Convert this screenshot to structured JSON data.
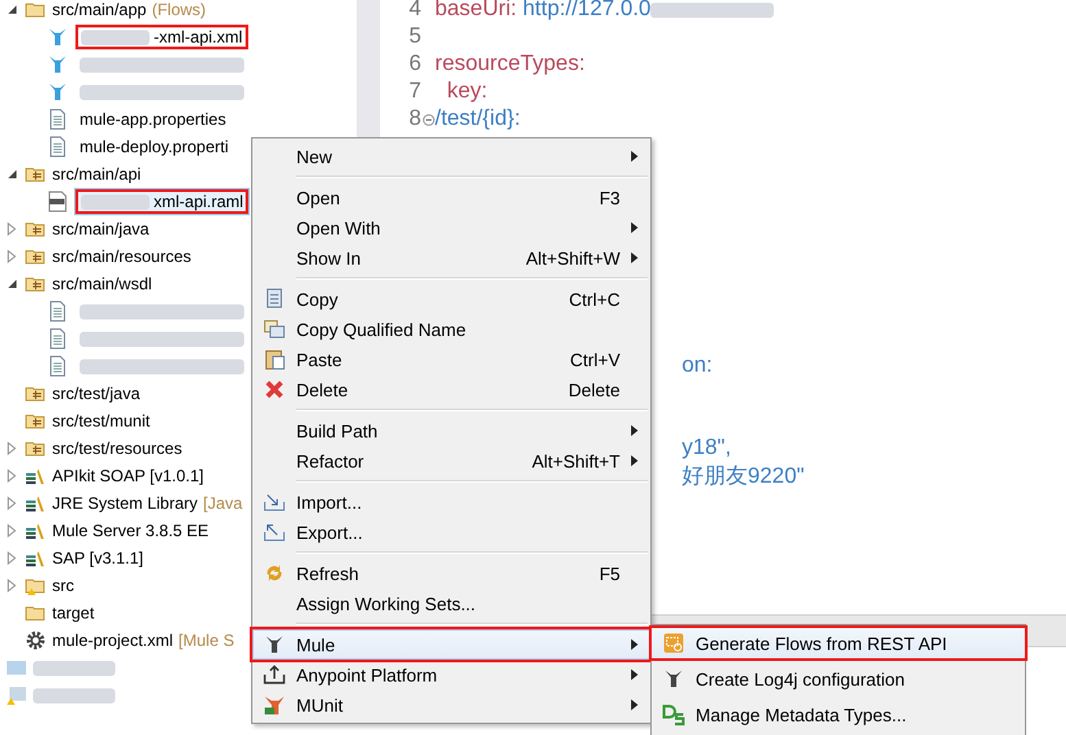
{
  "tree": [
    {
      "kind": "folder",
      "label": "src/main/app",
      "decoration": "(Flows)",
      "expanded": true,
      "children": [
        {
          "kind": "mule",
          "label": "-xml-api.xml",
          "blurred": true,
          "highlighted": true,
          "selected": false
        },
        {
          "kind": "mule",
          "blurred": true,
          "highlighted": false,
          "selected": false
        },
        {
          "kind": "mule",
          "blurred": true,
          "highlighted": false,
          "selected": false
        },
        {
          "kind": "file",
          "label": "mule-app.properties",
          "highlighted": false,
          "selected": false
        },
        {
          "kind": "file",
          "label": "mule-deploy.properti",
          "highlighted": false,
          "selected": false
        }
      ]
    },
    {
      "kind": "package",
      "label": "src/main/api",
      "expanded": true,
      "children": [
        {
          "kind": "raml",
          "label": "xml-api.raml",
          "blurred": true,
          "highlighted": true,
          "selected": true
        }
      ]
    },
    {
      "kind": "package",
      "label": "src/main/java",
      "expanded": false
    },
    {
      "kind": "package",
      "label": "src/main/resources",
      "expanded": false
    },
    {
      "kind": "package",
      "label": "src/main/wsdl",
      "expanded": true,
      "children": [
        {
          "kind": "file",
          "blurred": true,
          "highlighted": false,
          "selected": false
        },
        {
          "kind": "file",
          "blurred": true,
          "highlighted": false,
          "selected": false
        },
        {
          "kind": "file",
          "blurred": true,
          "highlighted": false,
          "selected": false
        }
      ]
    },
    {
      "kind": "package",
      "label": "src/test/java"
    },
    {
      "kind": "package",
      "label": "src/test/munit"
    },
    {
      "kind": "package",
      "label": "src/test/resources",
      "expanded": false
    },
    {
      "kind": "library",
      "label": "APIkit SOAP [v1.0.1]",
      "expanded": false
    },
    {
      "kind": "library",
      "label": "JRE System Library",
      "decoration": "[Java",
      "expanded": false
    },
    {
      "kind": "library",
      "label": "Mule Server 3.8.5 EE",
      "expanded": false
    },
    {
      "kind": "library",
      "label": "SAP [v3.1.1]",
      "expanded": false
    },
    {
      "kind": "warnfolder",
      "label": "src",
      "expanded": false
    },
    {
      "kind": "folder",
      "label": "target"
    },
    {
      "kind": "gear",
      "label": "mule-project.xml",
      "decoration": "[Mule S"
    }
  ],
  "projects": [
    {
      "kind": "project"
    },
    {
      "kind": "warnproject"
    }
  ],
  "editor": {
    "lines": [
      {
        "number": "4",
        "tokens": [
          {
            "kind": "key",
            "text": "baseUri:"
          },
          {
            "kind": "value",
            "text": "http://127.0.0"
          }
        ],
        "blurred": true
      },
      {
        "number": "5"
      },
      {
        "number": "6",
        "tokens": [
          {
            "kind": "key",
            "text": "resourceTypes:"
          }
        ]
      },
      {
        "number": "7",
        "tokens": [
          {
            "kind": "key",
            "text": "  key:"
          }
        ]
      },
      {
        "number": "8",
        "folded": false,
        "tokens": [
          {
            "kind": "value",
            "text": "/test/{id}:"
          }
        ]
      }
    ],
    "hidden_fragments": [
      "on:",
      "y18\",",
      "好朋友9220\""
    ]
  },
  "context_menu": {
    "groups": [
      [
        {
          "label": "New",
          "submenu": true
        }
      ],
      [
        {
          "label": "Open",
          "shortcut": "F3"
        },
        {
          "label": "Open With",
          "submenu": true
        },
        {
          "label": "Show In",
          "shortcut": "Alt+Shift+W",
          "submenu": true
        }
      ],
      [
        {
          "label": "Copy",
          "shortcut": "Ctrl+C"
        },
        {
          "label": "Copy Qualified Name"
        },
        {
          "label": "Paste",
          "shortcut": "Ctrl+V"
        },
        {
          "label": "Delete",
          "shortcut": "Delete"
        }
      ],
      [
        {
          "label": "Build Path",
          "submenu": true
        },
        {
          "label": "Refactor",
          "shortcut": "Alt+Shift+T",
          "submenu": true
        }
      ],
      [
        {
          "label": "Import..."
        },
        {
          "label": "Export..."
        }
      ],
      [
        {
          "label": "Refresh",
          "shortcut": "F5"
        },
        {
          "label": "Assign Working Sets..."
        }
      ],
      [
        {
          "label": "Mule",
          "submenu": true,
          "selected": true,
          "highlighted": true
        },
        {
          "label": "Anypoint Platform",
          "submenu": true,
          "selected": false,
          "highlighted": false
        },
        {
          "label": "MUnit",
          "submenu": true,
          "selected": false,
          "highlighted": false
        }
      ]
    ]
  },
  "submenu": {
    "items": [
      {
        "label": "Generate Flows from REST API",
        "selected": true,
        "highlighted": true
      },
      {
        "label": "Create Log4j configuration",
        "selected": false,
        "highlighted": false
      },
      {
        "label": "Manage Metadata Types...",
        "selected": false,
        "highlighted": false
      }
    ]
  }
}
